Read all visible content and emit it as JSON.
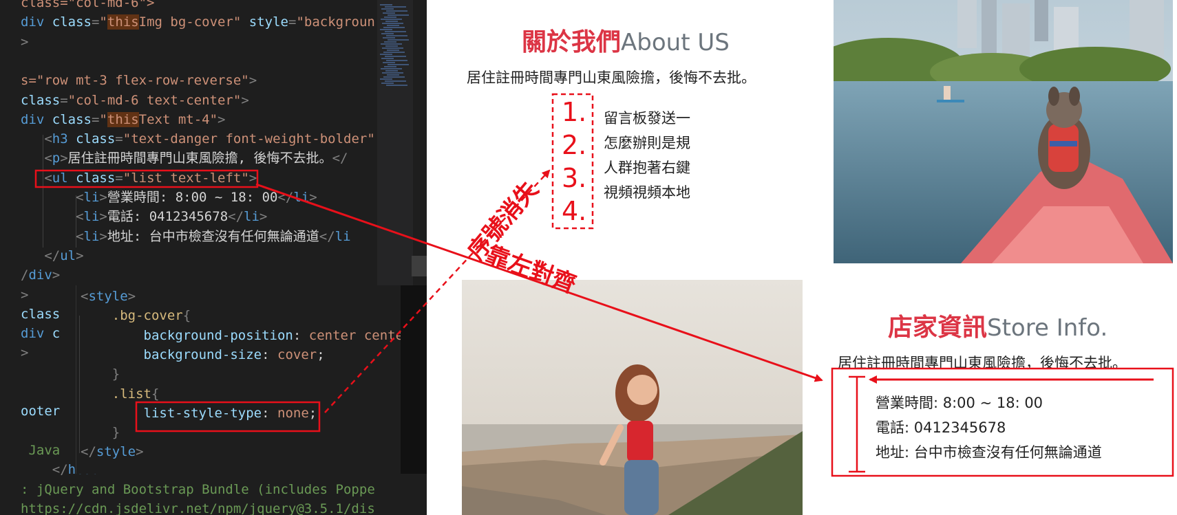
{
  "editor": {
    "lines": [
      {
        "parts": [
          [
            "class=\"col-md-6\">",
            "str"
          ]
        ]
      },
      {
        "parts": [
          [
            "div ",
            "tag"
          ],
          [
            "class",
            "attr"
          ],
          [
            "=",
            "punc"
          ],
          [
            "\"",
            "str"
          ],
          [
            "this",
            "str hl"
          ],
          [
            "Img bg-cover\" ",
            "str"
          ],
          [
            "style",
            "attr"
          ],
          [
            "=",
            "punc"
          ],
          [
            "\"backgroun",
            "str"
          ]
        ]
      },
      {
        "parts": [
          [
            ">",
            "punc"
          ]
        ]
      },
      {
        "parts": [
          [
            "",
            ""
          ]
        ]
      },
      {
        "parts": [
          [
            "s=\"row mt-3 flex-row-reverse\"",
            "str"
          ],
          [
            ">",
            "punc"
          ]
        ]
      },
      {
        "parts": [
          [
            "class",
            "attr"
          ],
          [
            "=",
            "punc"
          ],
          [
            "\"col-md-6 text-center\"",
            "str"
          ],
          [
            ">",
            "punc"
          ]
        ]
      },
      {
        "parts": [
          [
            "div ",
            "tag"
          ],
          [
            "class",
            "attr"
          ],
          [
            "=",
            "punc"
          ],
          [
            "\"",
            "str"
          ],
          [
            "this",
            "str hl"
          ],
          [
            "Text mt-4\"",
            "str"
          ],
          [
            ">",
            "punc"
          ]
        ]
      },
      {
        "parts": [
          [
            "   <",
            "punc"
          ],
          [
            "h3 ",
            "tag"
          ],
          [
            "class",
            "attr"
          ],
          [
            "=",
            "punc"
          ],
          [
            "\"text-danger font-weight-bolder\"",
            "str"
          ]
        ]
      },
      {
        "parts": [
          [
            "   <",
            "punc"
          ],
          [
            "p",
            "tag"
          ],
          [
            ">",
            "punc"
          ],
          [
            "居住註冊時間專門山東風險擔, 後悔不去批。",
            ""
          ],
          [
            "</",
            "punc"
          ]
        ]
      },
      {
        "parts": [
          [
            "   <",
            "punc"
          ],
          [
            "ul ",
            "tag"
          ],
          [
            "class",
            "attr"
          ],
          [
            "=",
            "punc"
          ],
          [
            "\"list text-left\"",
            "str"
          ],
          [
            ">",
            "punc"
          ]
        ]
      },
      {
        "parts": [
          [
            "       <",
            "punc"
          ],
          [
            "li",
            "tag"
          ],
          [
            ">",
            "punc"
          ],
          [
            "營業時間: 8:00 ~ 18: 00",
            ""
          ],
          [
            "</",
            "punc"
          ],
          [
            "li",
            "tag"
          ],
          [
            ">",
            "punc"
          ]
        ]
      },
      {
        "parts": [
          [
            "       <",
            "punc"
          ],
          [
            "li",
            "tag"
          ],
          [
            ">",
            "punc"
          ],
          [
            "電話: 0412345678",
            ""
          ],
          [
            "</",
            "punc"
          ],
          [
            "li",
            "tag"
          ],
          [
            ">",
            "punc"
          ]
        ]
      },
      {
        "parts": [
          [
            "       <",
            "punc"
          ],
          [
            "li",
            "tag"
          ],
          [
            ">",
            "punc"
          ],
          [
            "地址: 台中市檢查沒有任何無論通道",
            ""
          ],
          [
            "</",
            "punc"
          ],
          [
            "li",
            "tag"
          ]
        ]
      },
      {
        "parts": [
          [
            "   </",
            "punc"
          ],
          [
            "ul",
            "tag"
          ],
          [
            ">",
            "punc"
          ]
        ]
      },
      {
        "parts": [
          [
            "/",
            "punc"
          ],
          [
            "div",
            "tag"
          ],
          [
            ">",
            "punc"
          ]
        ]
      },
      {
        "parts": [
          [
            ">",
            "punc"
          ]
        ]
      },
      {
        "parts": [
          [
            "class",
            "attr"
          ]
        ]
      },
      {
        "parts": [
          [
            "div ",
            "tag"
          ],
          [
            "c",
            "attr"
          ]
        ]
      },
      {
        "parts": [
          [
            ">",
            "punc"
          ]
        ]
      },
      {
        "parts": [
          [
            "",
            ""
          ]
        ]
      },
      {
        "parts": [
          [
            "",
            ""
          ]
        ]
      },
      {
        "parts": [
          [
            "ooter",
            "attr"
          ]
        ]
      },
      {
        "parts": [
          [
            "",
            ""
          ]
        ]
      },
      {
        "parts": [
          [
            " Java",
            "comment-text"
          ]
        ]
      },
      {
        "parts": [
          [
            "    </",
            "punc"
          ],
          [
            "head",
            "tag"
          ]
        ]
      },
      {
        "parts": [
          [
            ": jQuery and Bootstrap Bundle (includes Poppe",
            "comment-text"
          ]
        ]
      },
      {
        "parts": [
          [
            "https://cdn.jsdelivr.net/npm/jquery@3.5.1/dis",
            "comment-text"
          ]
        ]
      }
    ],
    "style_block": [
      {
        "parts": [
          [
            "<",
            "punc"
          ],
          [
            "style",
            "tag"
          ],
          [
            ">",
            "punc"
          ]
        ]
      },
      {
        "parts": [
          [
            "    .bg-cover",
            "sel"
          ],
          [
            "{",
            "punc"
          ]
        ]
      },
      {
        "parts": [
          [
            "        background-position",
            "prop"
          ],
          [
            ": ",
            ""
          ],
          [
            "center cente",
            "val"
          ]
        ]
      },
      {
        "parts": [
          [
            "        background-size",
            "prop"
          ],
          [
            ": ",
            ""
          ],
          [
            "cover",
            "val"
          ],
          [
            ";",
            ""
          ]
        ]
      },
      {
        "parts": [
          [
            "    }",
            "punc"
          ]
        ]
      },
      {
        "parts": [
          [
            "    .list",
            "sel"
          ],
          [
            "{",
            "punc"
          ]
        ]
      },
      {
        "parts": [
          [
            "        list-style-type",
            "prop"
          ],
          [
            ": ",
            ""
          ],
          [
            "none",
            "val"
          ],
          [
            ";",
            ""
          ]
        ]
      },
      {
        "parts": [
          [
            "    }",
            "punc"
          ]
        ]
      },
      {
        "parts": [
          [
            "</",
            "punc"
          ],
          [
            "style",
            "tag"
          ],
          [
            ">",
            "punc"
          ]
        ]
      }
    ]
  },
  "about": {
    "title_zh": "關於我們",
    "title_en": "About US",
    "paragraph": "居住註冊時間專門山東風險擔，後悔不去批。",
    "numbers": [
      "1.",
      "2.",
      "3.",
      "4."
    ],
    "items": [
      "留言板發送一",
      "怎麼辦則是規",
      "人群抱著右鍵",
      "視頻視頻本地"
    ]
  },
  "store": {
    "title_zh": "店家資訊",
    "title_en": "Store Info.",
    "paragraph": "居住註冊時間專門山東風險擔，後悔不去批。",
    "items": [
      "營業時間: 8:00 ~ 18: 00",
      "電話: 0412345678",
      "地址: 台中市檢查沒有任何無論通道"
    ]
  },
  "annotations": {
    "numbers_gone": "序號消失",
    "align_left": "靠左對齊"
  },
  "colors": {
    "annotation_red": "#e8101a",
    "title_red": "#dc3545",
    "editor_bg": "#1e1e1e"
  }
}
